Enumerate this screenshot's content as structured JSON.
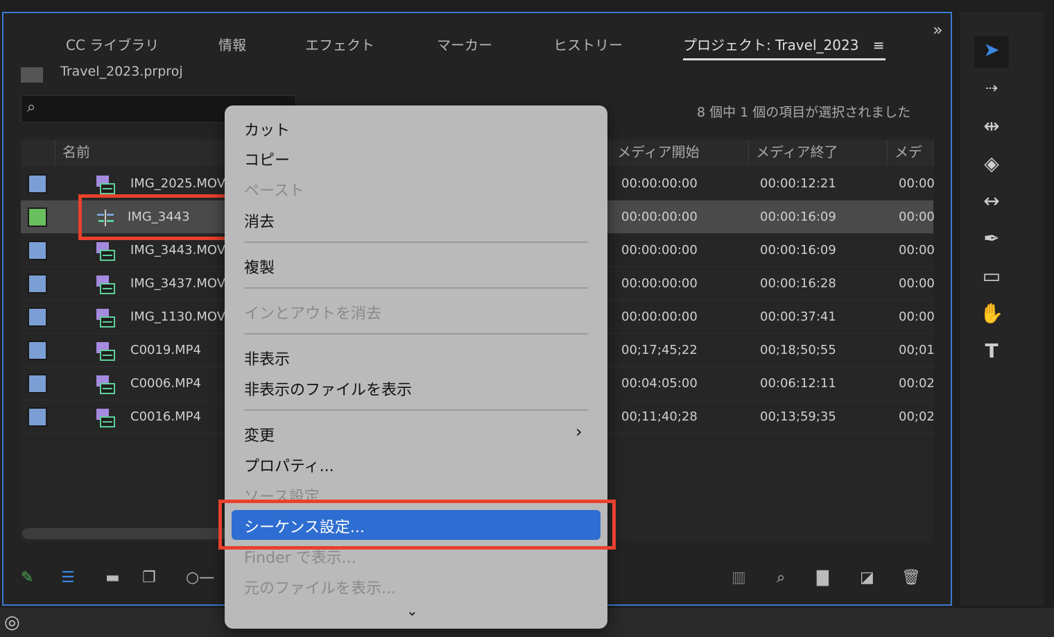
{
  "tabs": [
    "CC ライブラリ",
    "情報",
    "エフェクト",
    "マーカー",
    "ヒストリー",
    "プロジェクト: Travel_2023"
  ],
  "project_file": "Travel_2023.prproj",
  "search": {
    "placeholder": ""
  },
  "selection_status": "8 個中 1 個の項目が選択されました",
  "columns": [
    "名前",
    "メディア開始",
    "メディア終了",
    "メディ"
  ],
  "rows": [
    {
      "name": "IMG_2025.MOV",
      "start": "00:00:00:00",
      "end": "00:00:12:21",
      "dur": "00:00",
      "color": "#7b9fd4",
      "type": "clip"
    },
    {
      "name": "IMG_3443",
      "start": "00:00:00:00",
      "end": "00:00:16:09",
      "dur": "00:00",
      "color": "#6abf5e",
      "type": "sequence",
      "selected": true
    },
    {
      "name": "IMG_3443.MOV",
      "start": "00:00:00:00",
      "end": "00:00:16:09",
      "dur": "00:00",
      "color": "#7b9fd4",
      "type": "clip"
    },
    {
      "name": "IMG_3437.MOV",
      "start": "00:00:00:00",
      "end": "00:00:16:28",
      "dur": "00:00",
      "color": "#7b9fd4",
      "type": "clip"
    },
    {
      "name": "IMG_1130.MOV",
      "start": "00:00:00:00",
      "end": "00:00:37:41",
      "dur": "00:00",
      "color": "#7b9fd4",
      "type": "clip"
    },
    {
      "name": "C0019.MP4",
      "start": "00;17;45;22",
      "end": "00;18;50;55",
      "dur": "00;01",
      "color": "#7b9fd4",
      "type": "clip"
    },
    {
      "name": "C0006.MP4",
      "start": "00:04:05:00",
      "end": "00:06:12:11",
      "dur": "00:02",
      "color": "#7b9fd4",
      "type": "clip"
    },
    {
      "name": "C0016.MP4",
      "start": "00;11;40;28",
      "end": "00;13;59;35",
      "dur": "00;02",
      "color": "#7b9fd4",
      "type": "clip"
    }
  ],
  "menu": {
    "cut": "カット",
    "copy": "コピー",
    "paste": "ペースト",
    "clear": "消去",
    "duplicate": "複製",
    "clear_in_out": "インとアウトを消去",
    "hide": "非表示",
    "show_hidden": "非表示のファイルを表示",
    "modify": "変更",
    "properties": "プロパティ...",
    "source_settings": "ソース設定...",
    "sequence_settings": "シーケンス設定...",
    "reveal_finder": "Finder で表示...",
    "reveal_original": "元のファイルを表示..."
  },
  "colors": {
    "accent": "#2e6dd1",
    "highlight_box": "#e8412c"
  }
}
